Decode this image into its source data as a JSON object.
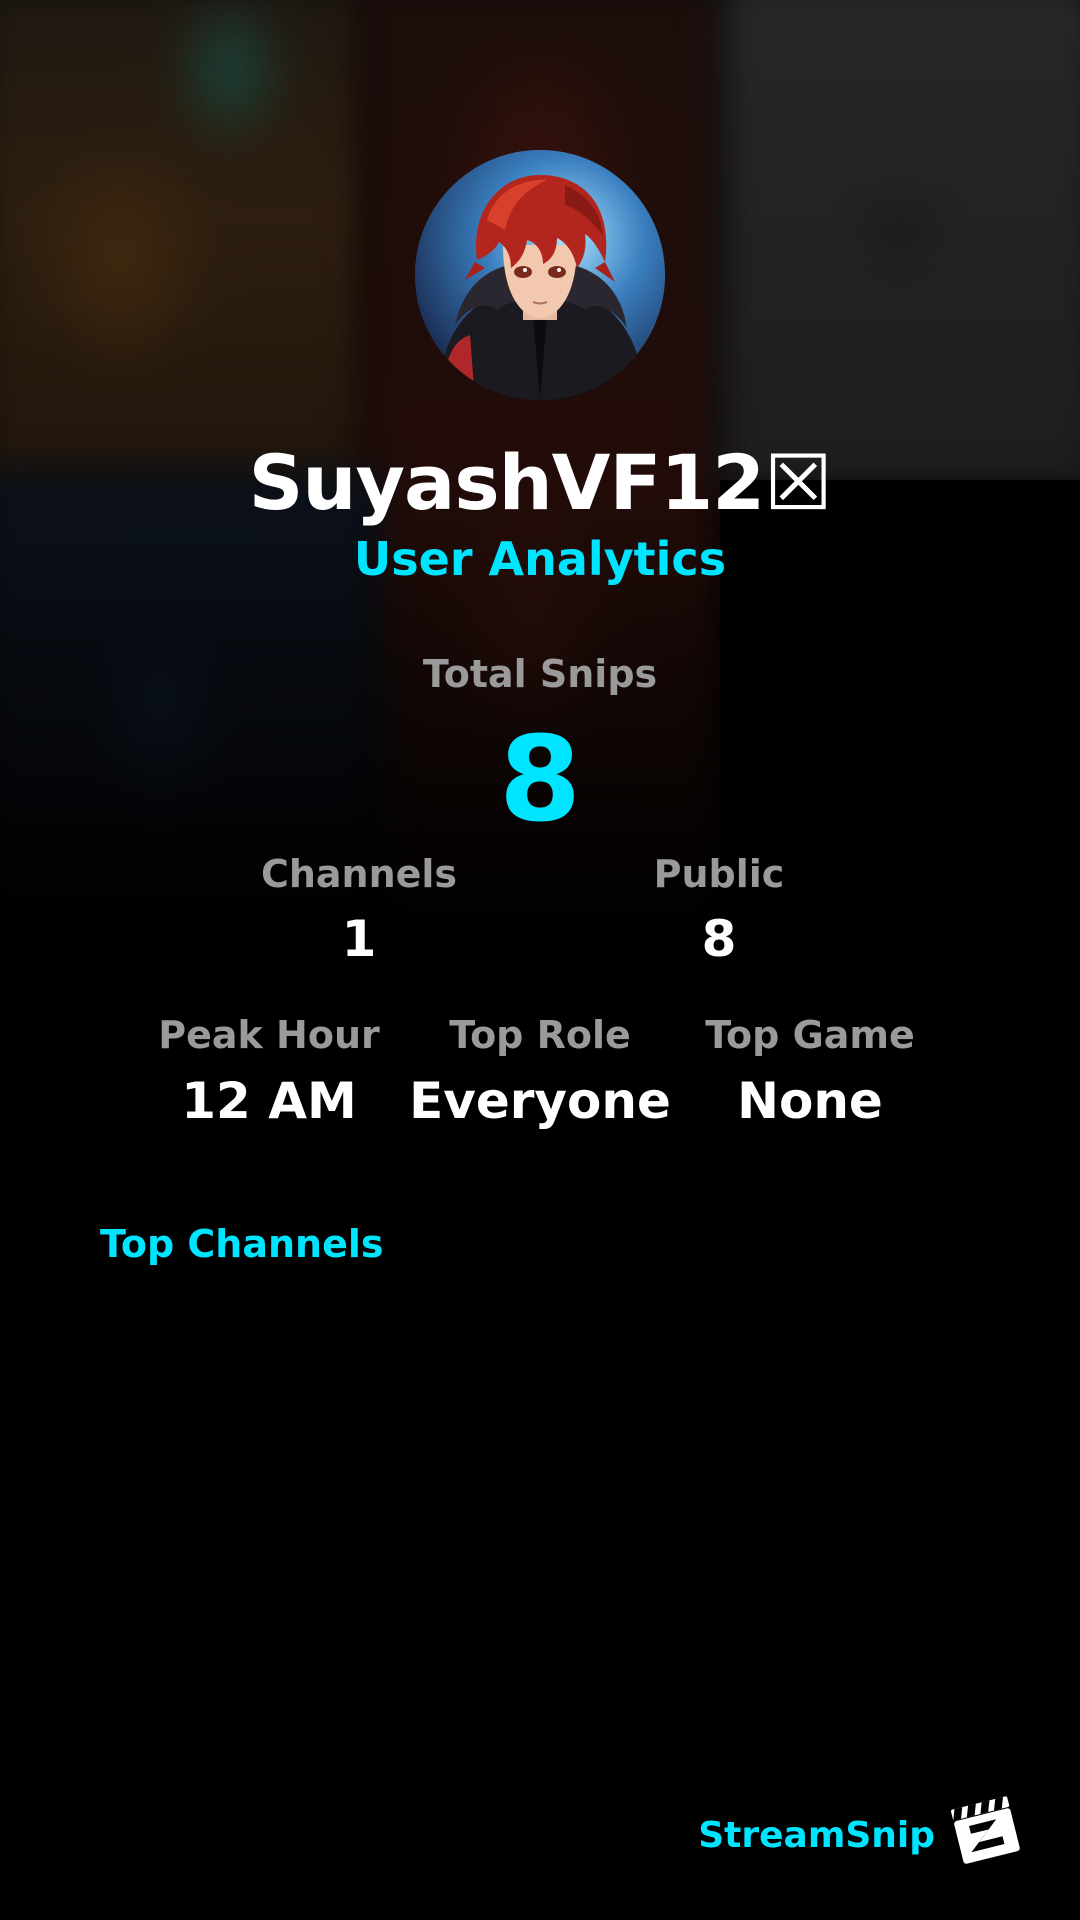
{
  "profile": {
    "username": "SuyashVF12☒",
    "subtitle": "User Analytics",
    "avatar_icon": "anime-avatar"
  },
  "stats": {
    "total_snips_label": "Total Snips",
    "total_snips_value": "8",
    "channels_label": "Channels",
    "channels_value": "1",
    "public_label": "Public",
    "public_value": "8",
    "peak_hour_label": "Peak Hour",
    "peak_hour_value": "12 AM",
    "top_role_label": "Top Role",
    "top_role_value": "Everyone",
    "top_game_label": "Top Game",
    "top_game_value": "None"
  },
  "sections": {
    "top_channels_title": "Top Channels"
  },
  "branding": {
    "name": "StreamSnip",
    "logo_icon": "clapperboard-icon"
  },
  "colors": {
    "accent": "#00e5ff",
    "label_gray": "#9a9a9a",
    "text": "#ffffff",
    "background": "#000000"
  }
}
